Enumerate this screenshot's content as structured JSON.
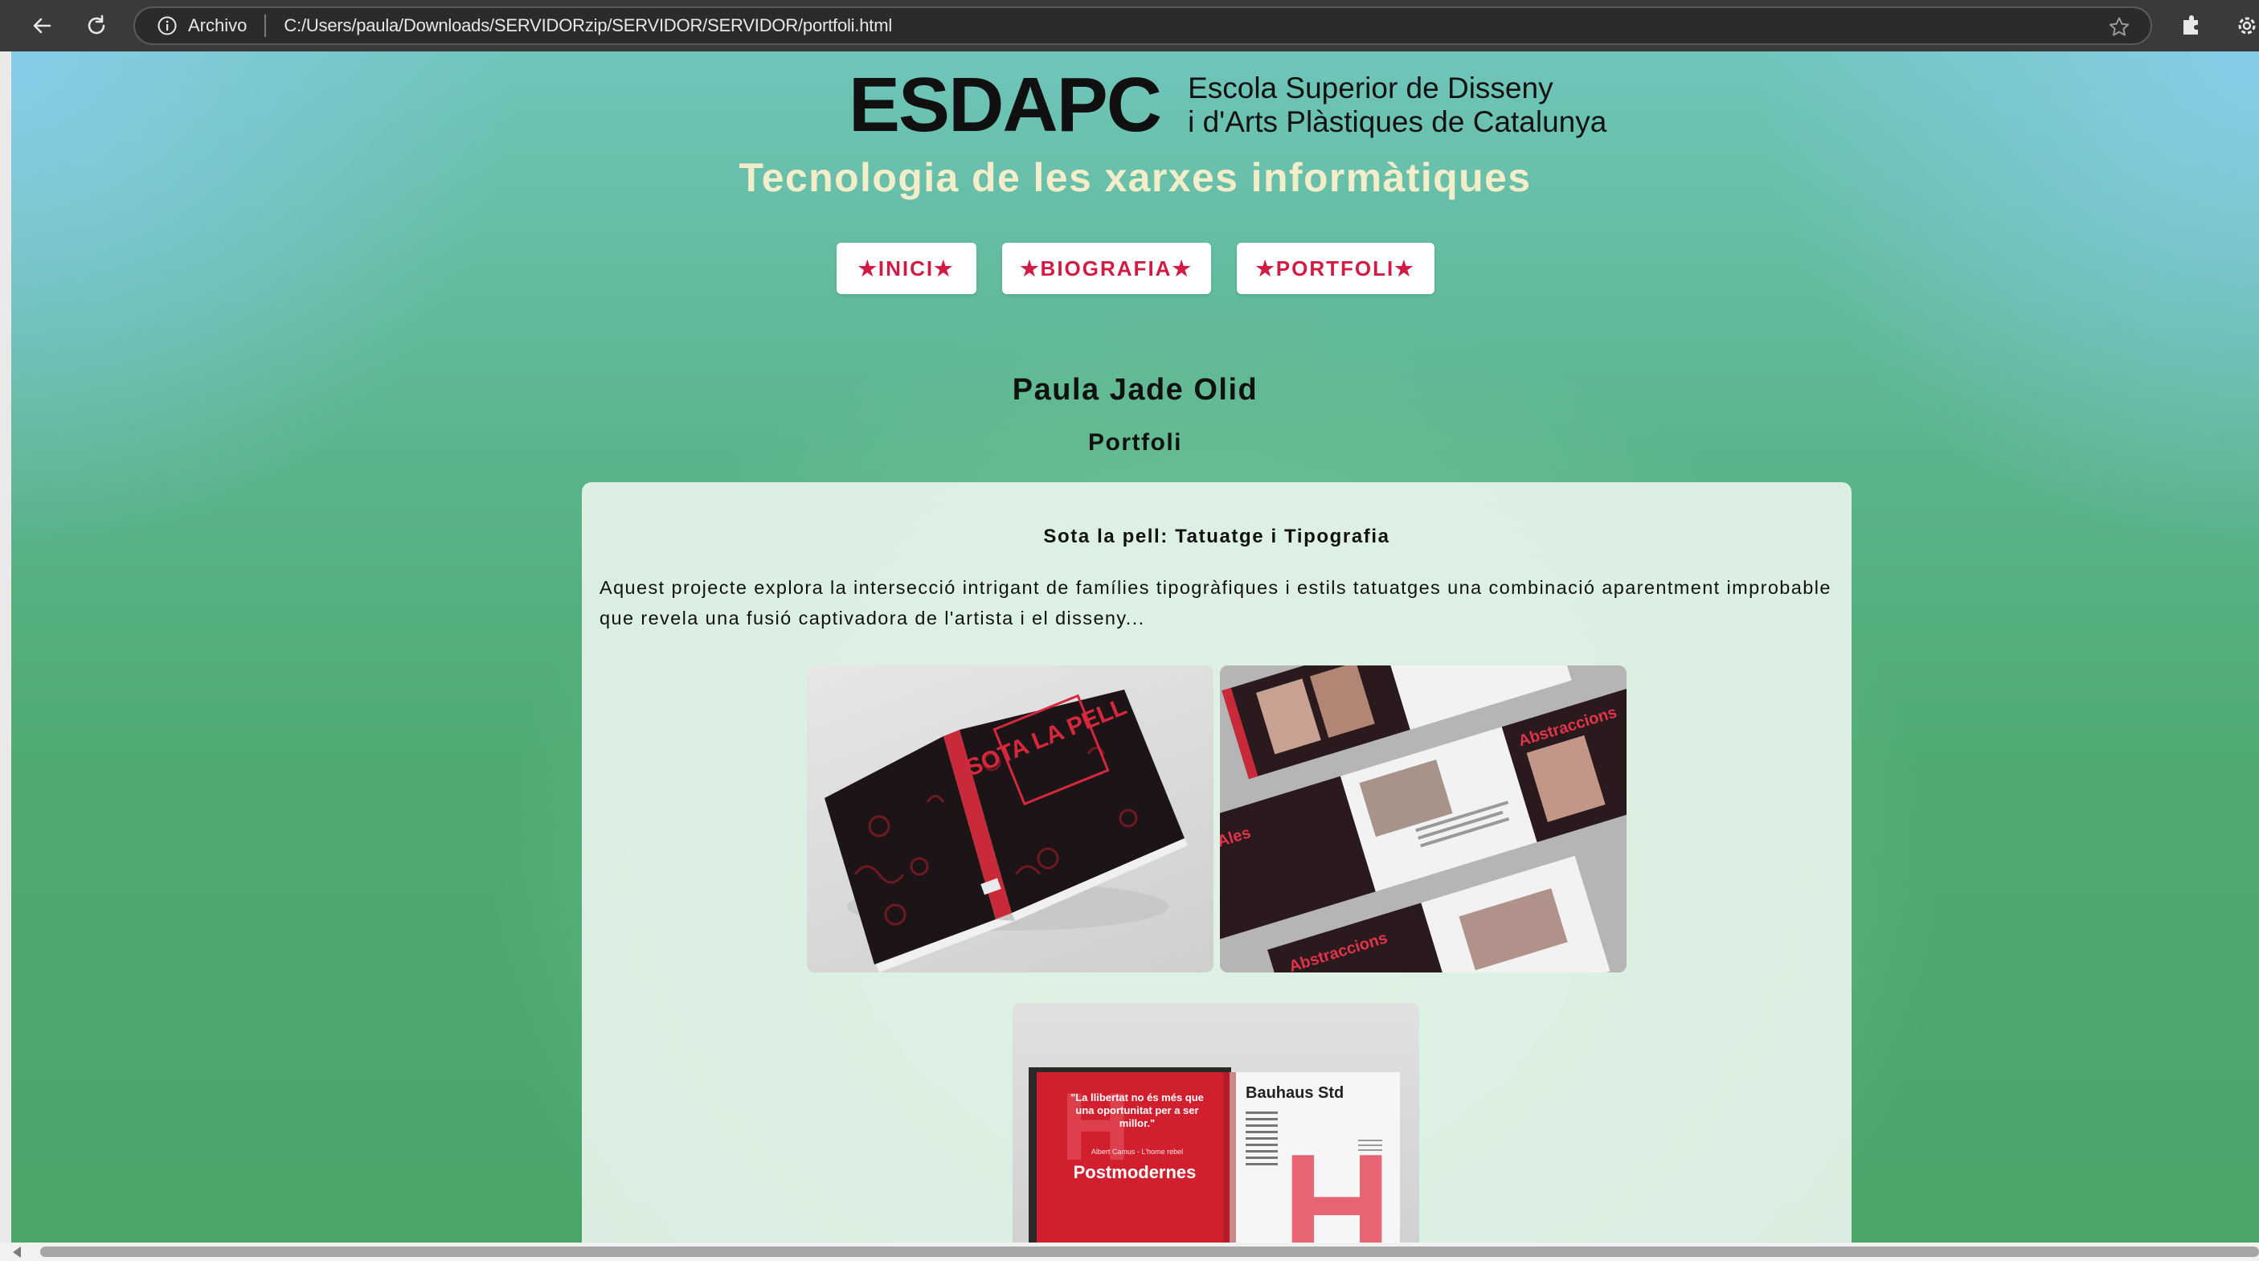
{
  "browser": {
    "scheme_label": "Archivo",
    "url": "C:/Users/paula/Downloads/SERVIDORzip/SERVIDOR/SERVIDOR/portfoli.html",
    "icons": [
      "back-arrow-icon",
      "reload-icon",
      "info-icon",
      "star-icon",
      "extensions-icon",
      "settings-icon"
    ]
  },
  "header": {
    "logo_mark": "ESDAPC",
    "logo_line1": "Escola Superior de Disseny",
    "logo_line2": "i d'Arts Plàstiques de Catalunya",
    "site_title": "Tecnologia de les xarxes informàtiques"
  },
  "nav": {
    "inici": "★INICI★",
    "biografia": "★BIOGRAFIA★",
    "portfoli": "★PORTFOLI★"
  },
  "main": {
    "author": "Paula Jade Olid",
    "section_title": "Portfoli",
    "project": {
      "title": "Sota la pell: Tatuatge i Tipografia",
      "description": "Aquest projecte explora la intersecció intrigant de famílies tipogràfiques i estils tatuatges  una combinació aparentment improbable que revela una fusió captivadora de l'artista i el disseny...",
      "images": {
        "cover": {
          "title": "SOTA LA PELL"
        },
        "spread_labels": [
          "Ales",
          "Abstraccions",
          "Abstraccions"
        ],
        "bauhaus": {
          "quote": "\"La llibertat no és més que una oportunitat per a ser millor.\"",
          "attribution": "Albert Camus - L'home rebel",
          "heading": "Postmodernes",
          "font_name": "Bauhaus Std"
        }
      }
    }
  },
  "colors": {
    "chrome": "#3a3a3a",
    "accent": "#d21b43",
    "title": "#f3edc9",
    "card": "#e6f4ea"
  }
}
